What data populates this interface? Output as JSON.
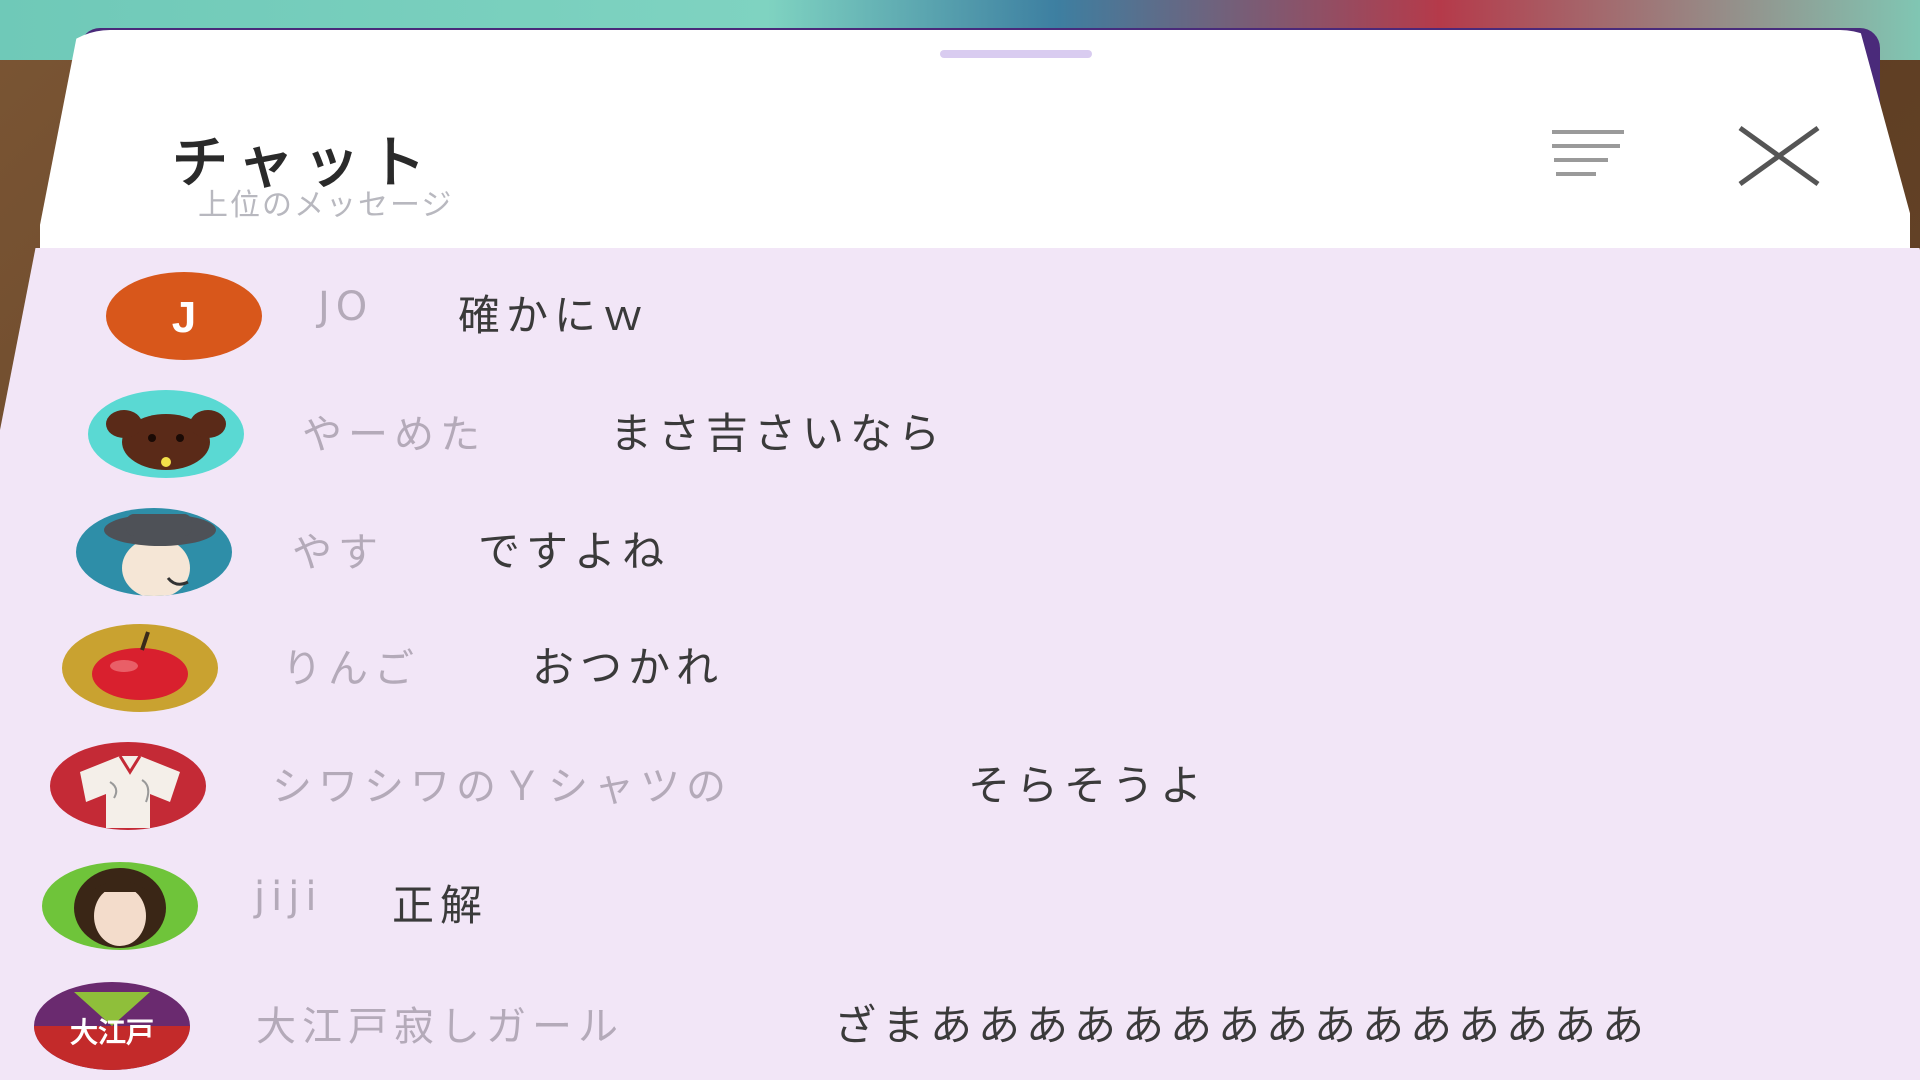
{
  "header": {
    "title": "チャット",
    "subtitle": "上位のメッセージ"
  },
  "icons": {
    "filter": "filter-icon",
    "close": "close-icon"
  },
  "colors": {
    "header_bg": "#ffffff",
    "list_bg": "#f2e6f7",
    "author_text": "#b4aab9",
    "message_text": "#3a3a3a",
    "avatar_jo": "#d8571b"
  },
  "messages": [
    {
      "author": "JO",
      "text": "確かにｗ",
      "avatar": "letter-avatar",
      "avatar_letter": "J"
    },
    {
      "author": "やーめた",
      "text": "まさ吉さいなら",
      "avatar": "dog-avatar"
    },
    {
      "author": "やす",
      "text": "ですよね",
      "avatar": "person-hat-avatar"
    },
    {
      "author": "りんご",
      "text": "おつかれ",
      "avatar": "apple-avatar"
    },
    {
      "author": "シワシワのＹシャツの",
      "text": "そらそうよ",
      "avatar": "shirt-avatar"
    },
    {
      "author": "jiji",
      "text": "正解",
      "avatar": "curly-hair-avatar"
    },
    {
      "author": "大江戸寂しガール",
      "text": "ざまあああああああああああああああ",
      "avatar": "oedo-logo-avatar",
      "avatar_text": "大江戸"
    }
  ]
}
